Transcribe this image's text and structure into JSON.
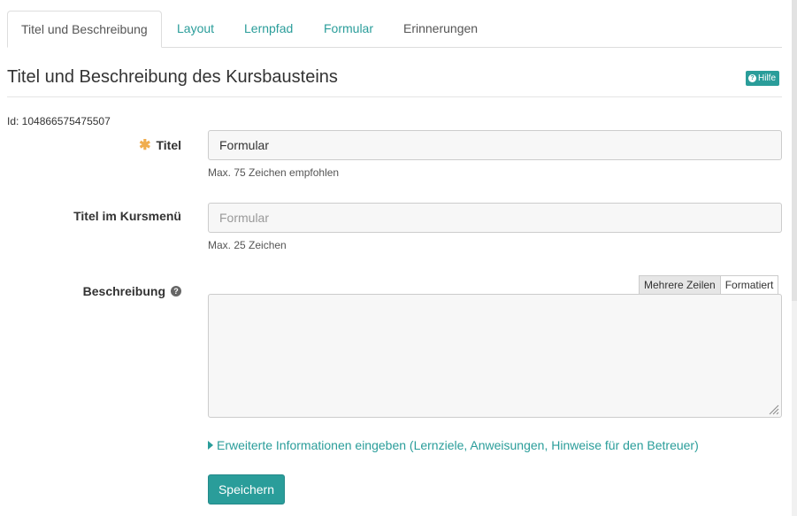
{
  "tabs": [
    {
      "label": "Titel und Beschreibung",
      "active": true
    },
    {
      "label": "Layout"
    },
    {
      "label": "Lernpfad"
    },
    {
      "label": "Formular"
    },
    {
      "label": "Erinnerungen"
    }
  ],
  "header": {
    "title": "Titel und Beschreibung des Kursbausteins",
    "help_label": "Hilfe",
    "id_text": "Id: 104866575475507"
  },
  "form": {
    "title_field": {
      "label": "Titel",
      "value": "Formular",
      "hint": "Max. 75 Zeichen empfohlen"
    },
    "menu_title_field": {
      "label": "Titel im Kursmenü",
      "placeholder": "Formular",
      "hint": "Max. 25 Zeichen"
    },
    "description_field": {
      "label": "Beschreibung",
      "mode_plain": "Mehrere Zeilen",
      "mode_rich": "Formatiert",
      "value": ""
    },
    "advanced_link": "Erweiterte Informationen eingeben (Lernziele, Anweisungen, Hinweise für den Betreuer)",
    "save_label": "Speichern"
  },
  "colors": {
    "accent": "#2a9d9a",
    "required": "#f0ad4e"
  }
}
